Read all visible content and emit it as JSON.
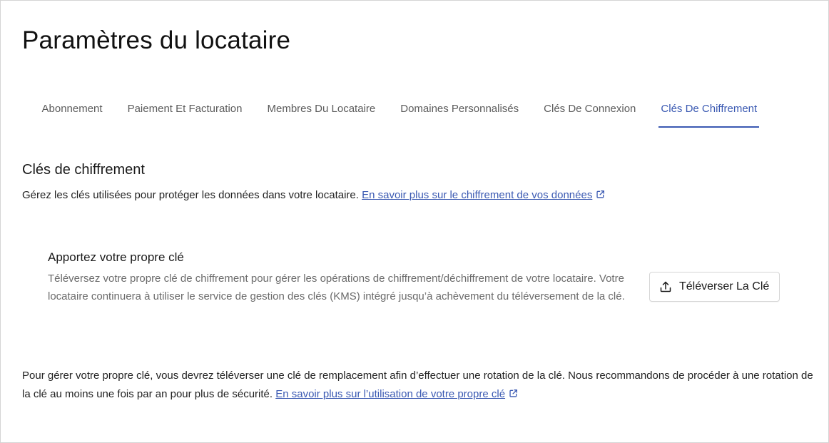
{
  "page": {
    "title": "Paramètres du locataire"
  },
  "tabs": [
    {
      "label": "Abonnement",
      "active": false
    },
    {
      "label": "Paiement Et Facturation",
      "active": false
    },
    {
      "label": "Membres Du Locataire",
      "active": false
    },
    {
      "label": "Domaines Personnalisés",
      "active": false
    },
    {
      "label": "Clés De Connexion",
      "active": false
    },
    {
      "label": "Clés De Chiffrement",
      "active": true
    }
  ],
  "encryption": {
    "title": "Clés de chiffrement",
    "description": "Gérez les clés utilisées pour protéger les données dans votre locataire.",
    "learn_more_link": "En savoir plus sur le chiffrement de vos données",
    "link_icon": "external-link-icon"
  },
  "byok": {
    "title": "Apportez votre propre clé",
    "description": "Téléversez votre propre clé de chiffrement pour gérer les opérations de chiffrement/déchiffrement de votre locataire. Votre locataire continuera à utiliser le service de gestion des clés (KMS) intégré jusqu’à achèvement du téléversement de la clé.",
    "upload_button_label": "Téléverser La Clé",
    "upload_icon": "upload-icon"
  },
  "footer": {
    "text": "Pour gérer votre propre clé, vous devrez téléverser une clé de remplacement afin d’effectuer une rotation de la clé. Nous recommandons de procéder à une rotation de la clé au moins une fois par an pour plus de sécurité.",
    "learn_more_link": "En savoir plus sur l’utilisation de votre propre clé",
    "link_icon": "external-link-icon"
  },
  "colors": {
    "accent": "#3a59b2",
    "text_primary": "#1a1a1a",
    "text_secondary": "#6b6b6b",
    "tab_inactive": "#5b5b5b",
    "border": "#d6d6d6"
  }
}
